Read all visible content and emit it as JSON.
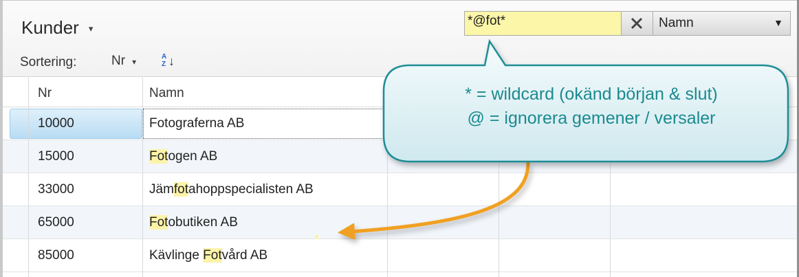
{
  "header": {
    "title": "Kunder",
    "title_caret": "▾",
    "sort_label": "Sortering:",
    "sort_value": "Nr",
    "sort_caret": "▾",
    "sort_icon": "sort-a-z-icon",
    "sort_icon_text": "A Z"
  },
  "search": {
    "value": "*@fot*",
    "clear_icon": "close-icon",
    "field_value": "Namn",
    "field_caret": "▼"
  },
  "grid": {
    "columns": [
      "Nr",
      "Namn"
    ],
    "rows": [
      {
        "nr": "10000",
        "name_parts": [
          {
            "t": "Fotograferna AB",
            "h": false
          }
        ],
        "selected": true
      },
      {
        "nr": "15000",
        "name_parts": [
          {
            "t": "Fot",
            "h": true
          },
          {
            "t": "ogen AB",
            "h": false
          }
        ]
      },
      {
        "nr": "33000",
        "name_parts": [
          {
            "t": "Jäm",
            "h": false
          },
          {
            "t": "fot",
            "h": true
          },
          {
            "t": "ahoppspecialisten AB",
            "h": false
          }
        ]
      },
      {
        "nr": "65000",
        "name_parts": [
          {
            "t": "Fot",
            "h": true
          },
          {
            "t": "obutiken AB",
            "h": false
          }
        ]
      },
      {
        "nr": "85000",
        "name_parts": [
          {
            "t": "Kävlinge ",
            "h": false
          },
          {
            "t": "Fot",
            "h": true
          },
          {
            "t": "vård AB",
            "h": false
          }
        ]
      }
    ]
  },
  "callout": {
    "line1": "* = wildcard (okänd början & slut)",
    "line2": "@ = ignorera gemener / versaler"
  },
  "colors": {
    "highlight": "#fcf3a9",
    "search_bg": "#fbf6a8",
    "selection": "#b9dcf3",
    "callout_border": "#1f8e96",
    "callout_text": "#1b8a8f",
    "arrow": "#f0a020"
  }
}
